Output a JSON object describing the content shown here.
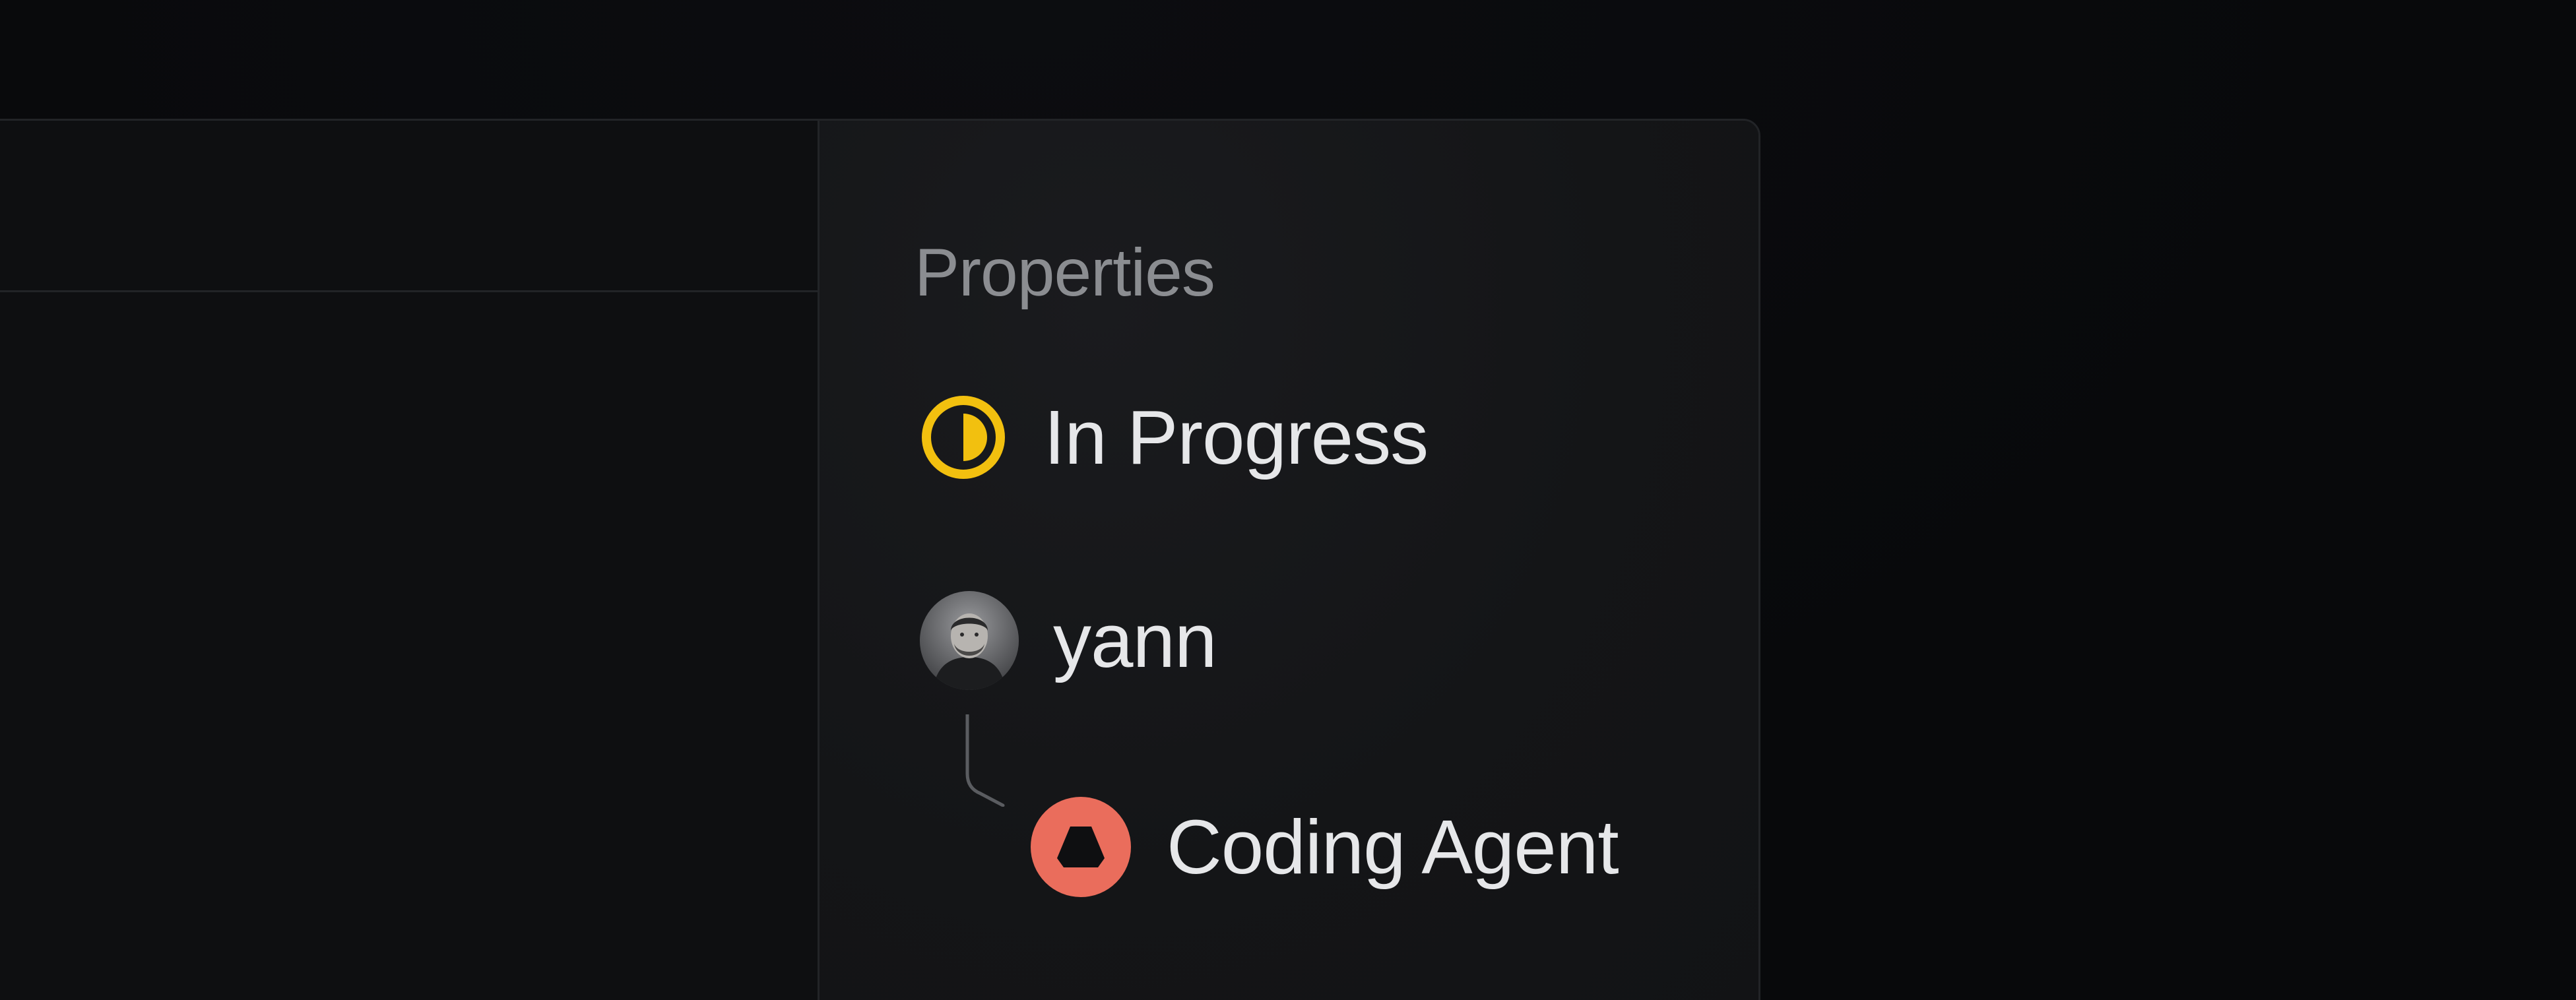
{
  "panel": {
    "title": "Properties"
  },
  "properties": {
    "status": {
      "label": "In Progress",
      "icon": "half-filled-circle-icon",
      "color": "#f2c00f"
    },
    "assignee": {
      "label": "yann",
      "icon": "user-avatar"
    },
    "delegate": {
      "label": "Coding Agent",
      "icon": "agent-logo-icon",
      "color": "#ea6d5c"
    }
  }
}
